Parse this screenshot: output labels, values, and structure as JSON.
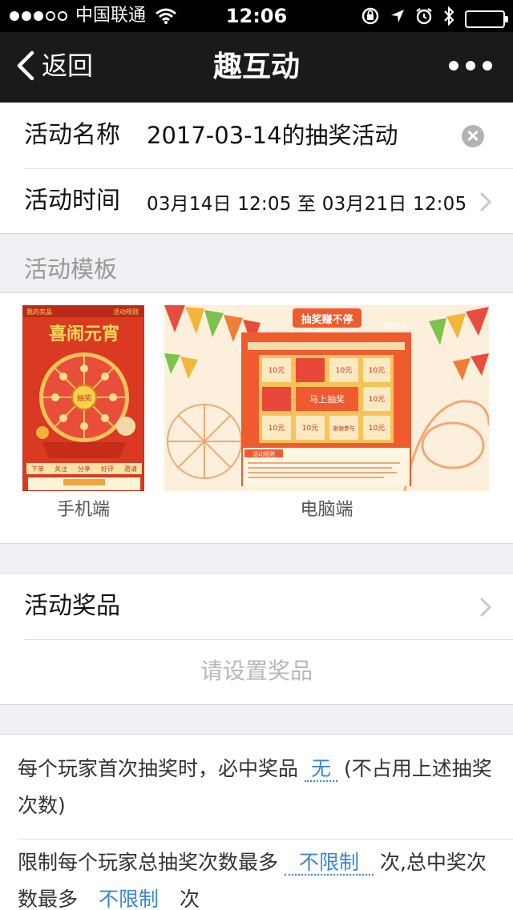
{
  "status_bar": {
    "carrier": "中国联通",
    "time": "12:06",
    "signal_dots_filled": 3,
    "signal_dots_total": 5,
    "icons": [
      "wifi-icon",
      "rotation-lock-icon",
      "location-icon",
      "alarm-icon",
      "bluetooth-icon",
      "battery-icon"
    ],
    "battery_level": 1.0
  },
  "nav": {
    "back_label": "返回",
    "title": "趣互动"
  },
  "form": {
    "name_label": "活动名称",
    "name_value": "2017-03-14的抽奖活动",
    "time_label": "活动时间",
    "time_value": "03月14日 12:05 至 03月21日 12:05"
  },
  "template_section": {
    "title": "活动模板",
    "mobile": {
      "caption": "手机端",
      "top_left": "我的奖品",
      "top_right": "活动规则",
      "headline": "喜闹元宵",
      "center": "抽奖",
      "tabs": [
        "下单",
        "关注",
        "分享",
        "好评",
        "邀请"
      ]
    },
    "pc": {
      "caption": "电脑端",
      "banner": "抽奖赚不停",
      "corner": "我的奖品",
      "cells": [
        "10元",
        "",
        "10元",
        "10元",
        "",
        "马上抽奖",
        "10元",
        "10元",
        "10元",
        "谢谢参与",
        "10元"
      ],
      "rules_title": "活动规则"
    }
  },
  "prize": {
    "label": "活动奖品",
    "empty_text": "请设置奖品"
  },
  "rules": {
    "first_draw_prefix": "每个玩家首次抽奖时，必中奖品",
    "first_draw_value": "无",
    "first_draw_suffix": "(不占用上述抽奖次数)",
    "limit_prefix": "限制每个玩家总抽奖次数最多",
    "limit_value": "不限制",
    "limit_middle": "次,总中奖次数最多",
    "limit_value2": "不限制",
    "limit_suffix": "次"
  },
  "colors": {
    "nav_bg": "#1a1a1a",
    "link": "#3a86d6",
    "page_bg": "#efeff4"
  }
}
